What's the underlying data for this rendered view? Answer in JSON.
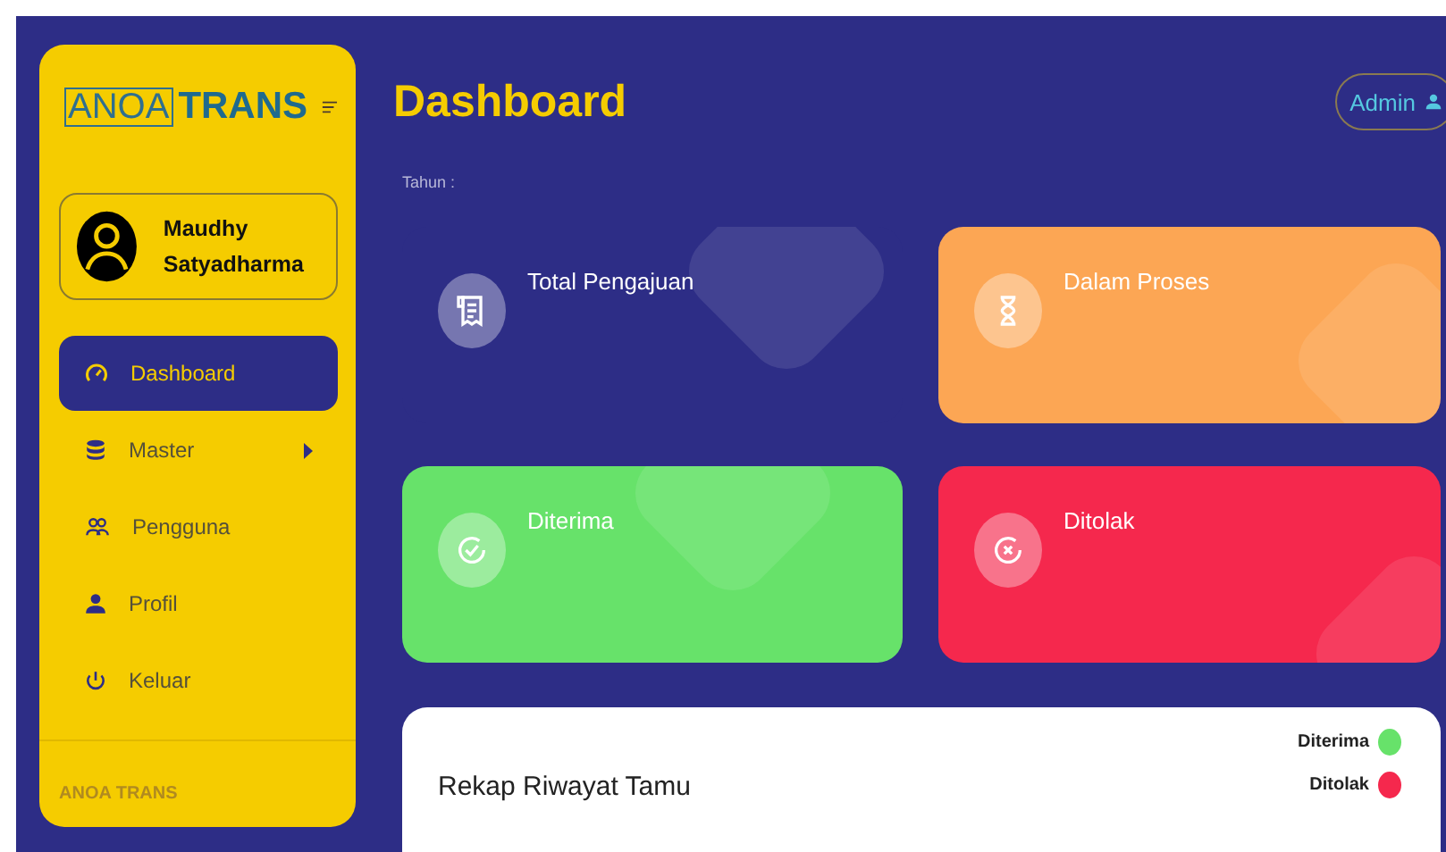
{
  "brand": {
    "part_1": "ANOA",
    "part_2": "TRANS"
  },
  "user": {
    "name": "Maudhy Satyadharma"
  },
  "menu": [
    {
      "label": "Dashboard",
      "kind": "gauge",
      "selected": true,
      "has_submenu": false
    },
    {
      "label": "Master",
      "kind": "database",
      "selected": false,
      "has_submenu": true
    },
    {
      "label": "Pengguna",
      "kind": "users",
      "selected": false,
      "has_submenu": false
    },
    {
      "label": "Profil",
      "kind": "user",
      "selected": false,
      "has_submenu": false
    },
    {
      "label": "Keluar",
      "kind": "power",
      "selected": false,
      "has_submenu": false
    }
  ],
  "sidebar_footer": {
    "title": "ANOA TRANS"
  },
  "header": {
    "title": "Dashboard",
    "account": "Admin"
  },
  "filter": {
    "label": "Tahun :"
  },
  "stats": [
    {
      "label": "Total Pengajuan",
      "kind": "total",
      "color": "#2d2d86"
    },
    {
      "label": "Dalam Proses",
      "kind": "process",
      "color": "#fca654"
    },
    {
      "label": "Diterima",
      "kind": "accepted",
      "color": "#67e26a"
    },
    {
      "label": "Ditolak",
      "kind": "rejected",
      "color": "#f5284d"
    }
  ],
  "recap": {
    "title": "Rekap Riwayat Tamu",
    "legend": [
      {
        "label": "Diterima",
        "color": "#67e26a"
      },
      {
        "label": "Ditolak",
        "color": "#f5284d"
      }
    ]
  }
}
